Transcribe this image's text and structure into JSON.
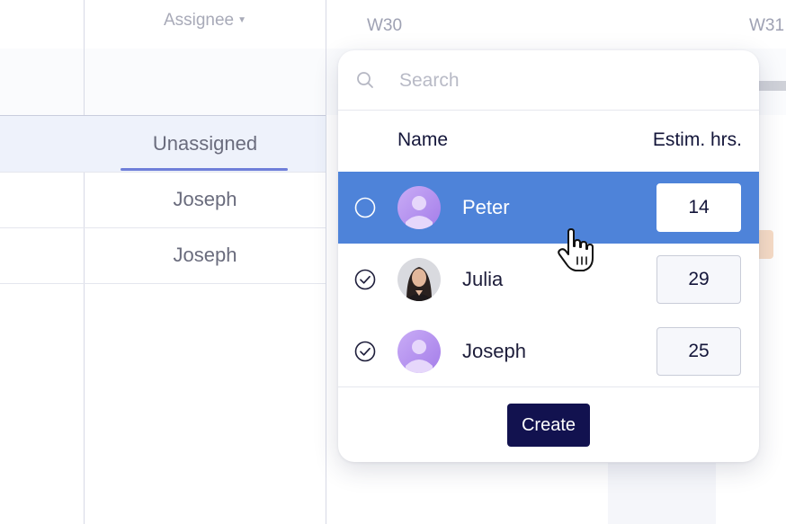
{
  "header": {
    "assignee_label": "Assignee",
    "weeks": [
      "W30",
      "W31"
    ]
  },
  "rows": [
    {
      "assignee": "Unassigned",
      "selected": true
    },
    {
      "assignee": "Joseph",
      "selected": false
    },
    {
      "assignee": "Joseph",
      "selected": false
    }
  ],
  "popup": {
    "search_placeholder": "Search",
    "search_value": "",
    "col_name": "Name",
    "col_hours": "Estim. hrs.",
    "people": [
      {
        "name": "Peter",
        "hours": "14",
        "state": "hovered",
        "avatar": "placeholder-avatar-icon"
      },
      {
        "name": "Julia",
        "hours": "29",
        "state": "checked",
        "avatar": "photo"
      },
      {
        "name": "Joseph",
        "hours": "25",
        "state": "checked",
        "avatar": "placeholder-avatar-icon"
      }
    ],
    "create_label": "Create"
  },
  "colors": {
    "highlight": "#4e83d9",
    "create_button": "#12124f",
    "underline": "#6f7fd9",
    "avatar_gradient": [
      "#c7a7f5",
      "#a983ec"
    ]
  },
  "icons": {
    "search": "search-icon",
    "radio_empty": "radio-empty-icon",
    "checked": "check-circle-icon",
    "cursor": "hand-pointer-icon"
  }
}
